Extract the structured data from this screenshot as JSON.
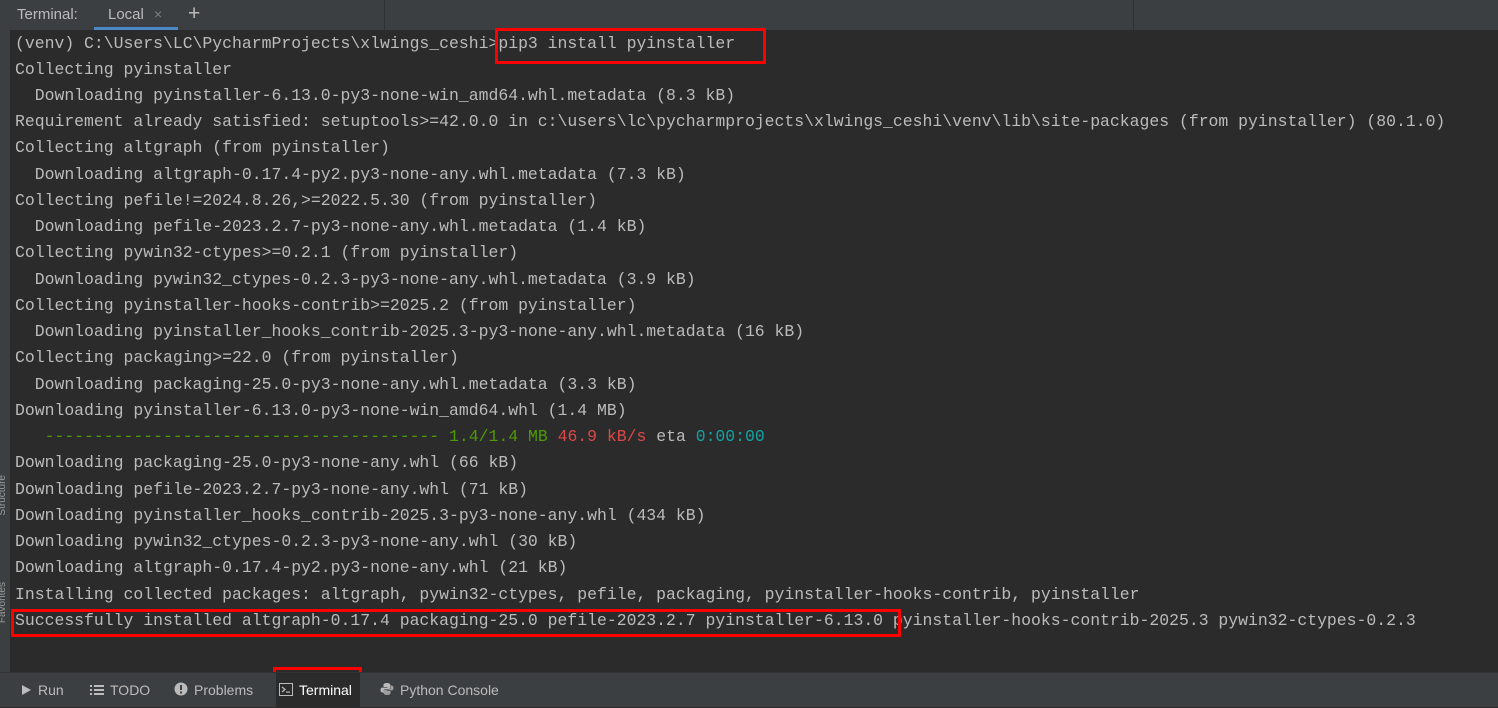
{
  "tabbar": {
    "title": "Terminal:",
    "tab_local": "Local",
    "close_glyph": "×",
    "new_tab_glyph": "+"
  },
  "terminal": {
    "prompt": "(venv) C:\\Users\\LC\\PycharmProjects\\xlwings_ceshi>",
    "command": "pip3 install pyinstaller",
    "lines": [
      "Collecting pyinstaller",
      "  Downloading pyinstaller-6.13.0-py3-none-win_amd64.whl.metadata (8.3 kB)",
      "Requirement already satisfied: setuptools>=42.0.0 in c:\\users\\lc\\pycharmprojects\\xlwings_ceshi\\venv\\lib\\site-packages (from pyinstaller) (80.1.0)",
      "Collecting altgraph (from pyinstaller)",
      "  Downloading altgraph-0.17.4-py2.py3-none-any.whl.metadata (7.3 kB)",
      "Collecting pefile!=2024.8.26,>=2022.5.30 (from pyinstaller)",
      "  Downloading pefile-2023.2.7-py3-none-any.whl.metadata (1.4 kB)",
      "Collecting pywin32-ctypes>=0.2.1 (from pyinstaller)",
      "  Downloading pywin32_ctypes-0.2.3-py3-none-any.whl.metadata (3.9 kB)",
      "Collecting pyinstaller-hooks-contrib>=2025.2 (from pyinstaller)",
      "  Downloading pyinstaller_hooks_contrib-2025.3-py3-none-any.whl.metadata (16 kB)",
      "Collecting packaging>=22.0 (from pyinstaller)",
      "  Downloading packaging-25.0-py3-none-any.whl.metadata (3.3 kB)",
      "Downloading pyinstaller-6.13.0-py3-none-win_amd64.whl (1.4 MB)"
    ],
    "progress": {
      "bar": "   ----------------------------------------",
      "size": "1.4/1.4 MB",
      "speed": "46.9 kB/s",
      "eta_label": "eta",
      "eta_value": "0:00:00"
    },
    "lines2": [
      "Downloading packaging-25.0-py3-none-any.whl (66 kB)",
      "Downloading pefile-2023.2.7-py3-none-any.whl (71 kB)",
      "Downloading pyinstaller_hooks_contrib-2025.3-py3-none-any.whl (434 kB)",
      "Downloading pywin32_ctypes-0.2.3-py3-none-any.whl (30 kB)",
      "Downloading altgraph-0.17.4-py2.py3-none-any.whl (21 kB)",
      "Installing collected packages: altgraph, pywin32-ctypes, pefile, packaging, pyinstaller-hooks-contrib, pyinstaller"
    ],
    "success_part1": "Successfully installed altgraph-0.17.4 packaging-25.0 pefile-2023.2.7 pyinstaller-6.13.0",
    "success_part2": " pyinstaller-hooks-contrib-2025.3 pywin32-ctypes-0.2.3"
  },
  "side_labels": [
    "Structure",
    "Favorites"
  ],
  "toolbar": {
    "run": "Run",
    "todo": "TODO",
    "problems": "Problems",
    "terminal": "Terminal",
    "python_console": "Python Console"
  },
  "colors": {
    "highlight": "#ff0000",
    "progress_bar": "#4e9a06",
    "speed": "#dd4848",
    "eta": "#12a3a3"
  }
}
